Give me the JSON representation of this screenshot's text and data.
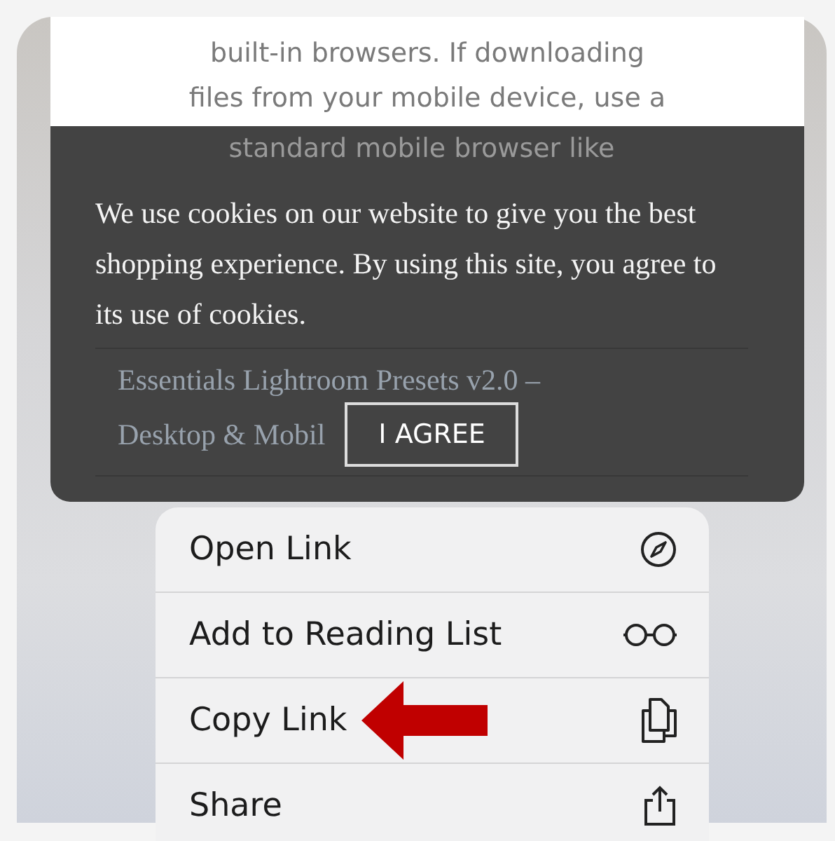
{
  "page_preview": {
    "body_lines": [
      "built-in browsers. If downloading",
      "files from your mobile device, use a",
      "standard mobile browser like"
    ],
    "cookie_banner": {
      "message": "We use cookies on our website to give you the best shopping experience. By using this site, you agree to its use of cookies.",
      "link_lines": [
        "Essentials Lightroom Presets v2.0 –",
        "Desktop & Mobil"
      ],
      "button": "I AGREE"
    }
  },
  "context_menu": {
    "items": [
      {
        "label": "Open Link",
        "kind": "open",
        "annotated": false
      },
      {
        "label": "Add to Reading List",
        "kind": "reading",
        "annotated": false
      },
      {
        "label": "Copy Link",
        "kind": "copy",
        "annotated": true
      },
      {
        "label": "Share",
        "kind": "share",
        "annotated": false
      }
    ]
  }
}
